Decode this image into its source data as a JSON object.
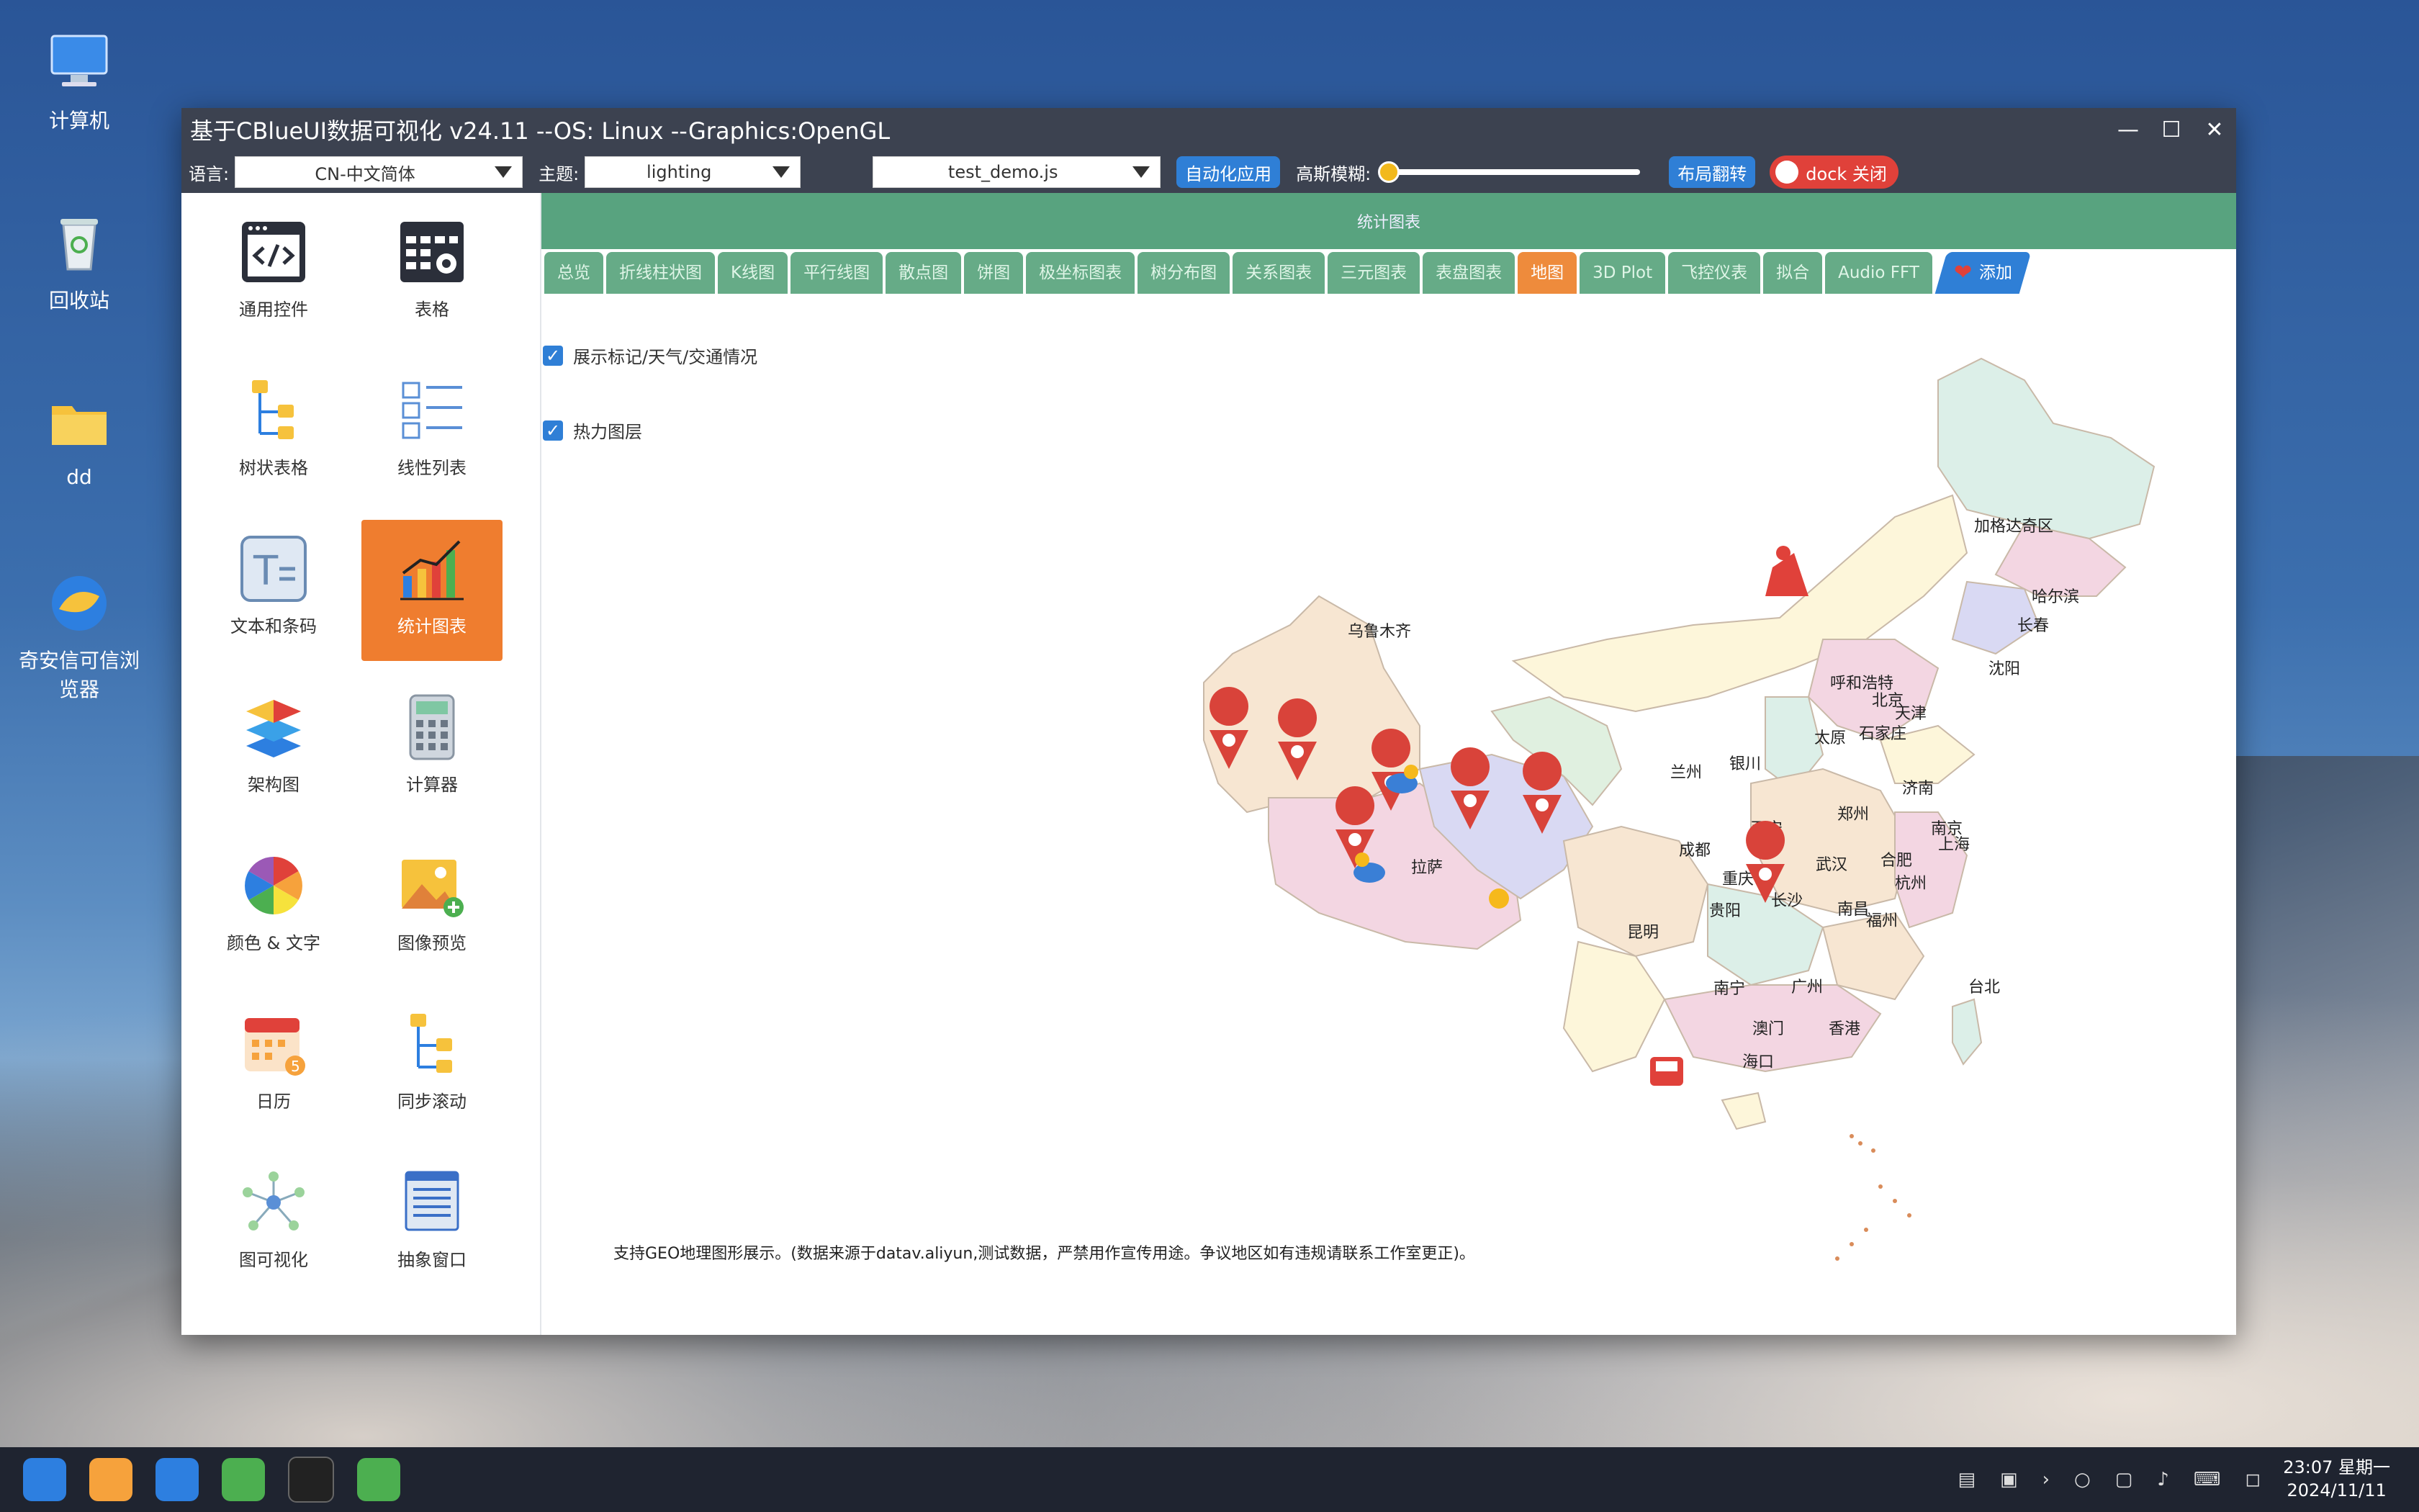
{
  "desktop": {
    "icons": [
      {
        "label": "计算机",
        "icon": "computer-icon"
      },
      {
        "label": "回收站",
        "icon": "recycle-bin-icon"
      },
      {
        "label": "dd",
        "icon": "folder-icon"
      },
      {
        "label": "奇安信可信浏览器",
        "icon": "browser-icon"
      }
    ]
  },
  "window": {
    "title": "基于CBlueUI数据可视化  v24.11  --OS: Linux  --Graphics:OpenGL",
    "controls": {
      "minimize": "—",
      "maximize": "☐",
      "close": "✕"
    }
  },
  "toolbar": {
    "language_label": "语言:",
    "language_value": "CN-中文简体",
    "theme_label": "主题:",
    "theme_value": "lighting",
    "script_value": "test_demo.js",
    "auto_apply": "自动化应用",
    "blur_label": "高斯模糊:",
    "blur_level": 0.0,
    "layout_flip": "布局翻转",
    "dock_close": "dock 关闭"
  },
  "sidebar": {
    "items": [
      {
        "label": "通用控件",
        "icon": "code-window-icon"
      },
      {
        "label": "表格",
        "icon": "table-settings-icon"
      },
      {
        "label": "树状表格",
        "icon": "tree-table-icon"
      },
      {
        "label": "线性列表",
        "icon": "linear-list-icon"
      },
      {
        "label": "文本和条码",
        "icon": "text-icon"
      },
      {
        "label": "统计图表",
        "icon": "bar-chart-icon"
      },
      {
        "label": "架构图",
        "icon": "layers-icon"
      },
      {
        "label": "计算器",
        "icon": "calculator-icon"
      },
      {
        "label": "颜色 & 文字",
        "icon": "color-wheel-icon"
      },
      {
        "label": "图像预览",
        "icon": "image-preview-icon"
      },
      {
        "label": "日历",
        "icon": "calendar-icon"
      },
      {
        "label": "同步滚动",
        "icon": "sync-scroll-icon"
      },
      {
        "label": "图可视化",
        "icon": "graph-icon"
      },
      {
        "label": "抽象窗口",
        "icon": "abstract-window-icon"
      }
    ],
    "active_index": 5
  },
  "content": {
    "header": "统计图表",
    "tabs": [
      "总览",
      "折线柱状图",
      "K线图",
      "平行线图",
      "散点图",
      "饼图",
      "极坐标图表",
      "树分布图",
      "关系图表",
      "三元图表",
      "表盘图表",
      "地图",
      "3D Plot",
      "飞控仪表",
      "拟合",
      "Audio FFT"
    ],
    "active_tab": "地图",
    "add_tab": "添加",
    "check_markers": "展示标记/天气/交通情况",
    "check_heat": "热力图层",
    "footer_note": "支持GEO地理图形展示。(数据来源于datav.aliyun,测试数据，严禁用作宣传用途。争议地区如有违规请联系工作室更正)。"
  },
  "map": {
    "cities": [
      {
        "name": "加格达奇区"
      },
      {
        "name": "哈尔滨"
      },
      {
        "name": "长春"
      },
      {
        "name": "沈阳"
      },
      {
        "name": "乌鲁木齐"
      },
      {
        "name": "呼和浩特"
      },
      {
        "name": "北京"
      },
      {
        "name": "天津"
      },
      {
        "name": "石家庄"
      },
      {
        "name": "太原"
      },
      {
        "name": "银川"
      },
      {
        "name": "兰州"
      },
      {
        "name": "济南"
      },
      {
        "name": "郑州"
      },
      {
        "name": "西安"
      },
      {
        "name": "南京"
      },
      {
        "name": "上海"
      },
      {
        "name": "合肥"
      },
      {
        "name": "武汉"
      },
      {
        "name": "成都"
      },
      {
        "name": "拉萨"
      },
      {
        "name": "重庆"
      },
      {
        "name": "杭州"
      },
      {
        "name": "长沙"
      },
      {
        "name": "贵阳"
      },
      {
        "name": "南昌"
      },
      {
        "name": "福州"
      },
      {
        "name": "昆明"
      },
      {
        "name": "南宁"
      },
      {
        "name": "广州"
      },
      {
        "name": "台北"
      },
      {
        "name": "澳门"
      },
      {
        "name": "香港"
      },
      {
        "name": "海口"
      }
    ],
    "pin_color": "#d9433a"
  },
  "taskbar": {
    "time": "23:07 星期一",
    "date": "2024/11/11"
  }
}
